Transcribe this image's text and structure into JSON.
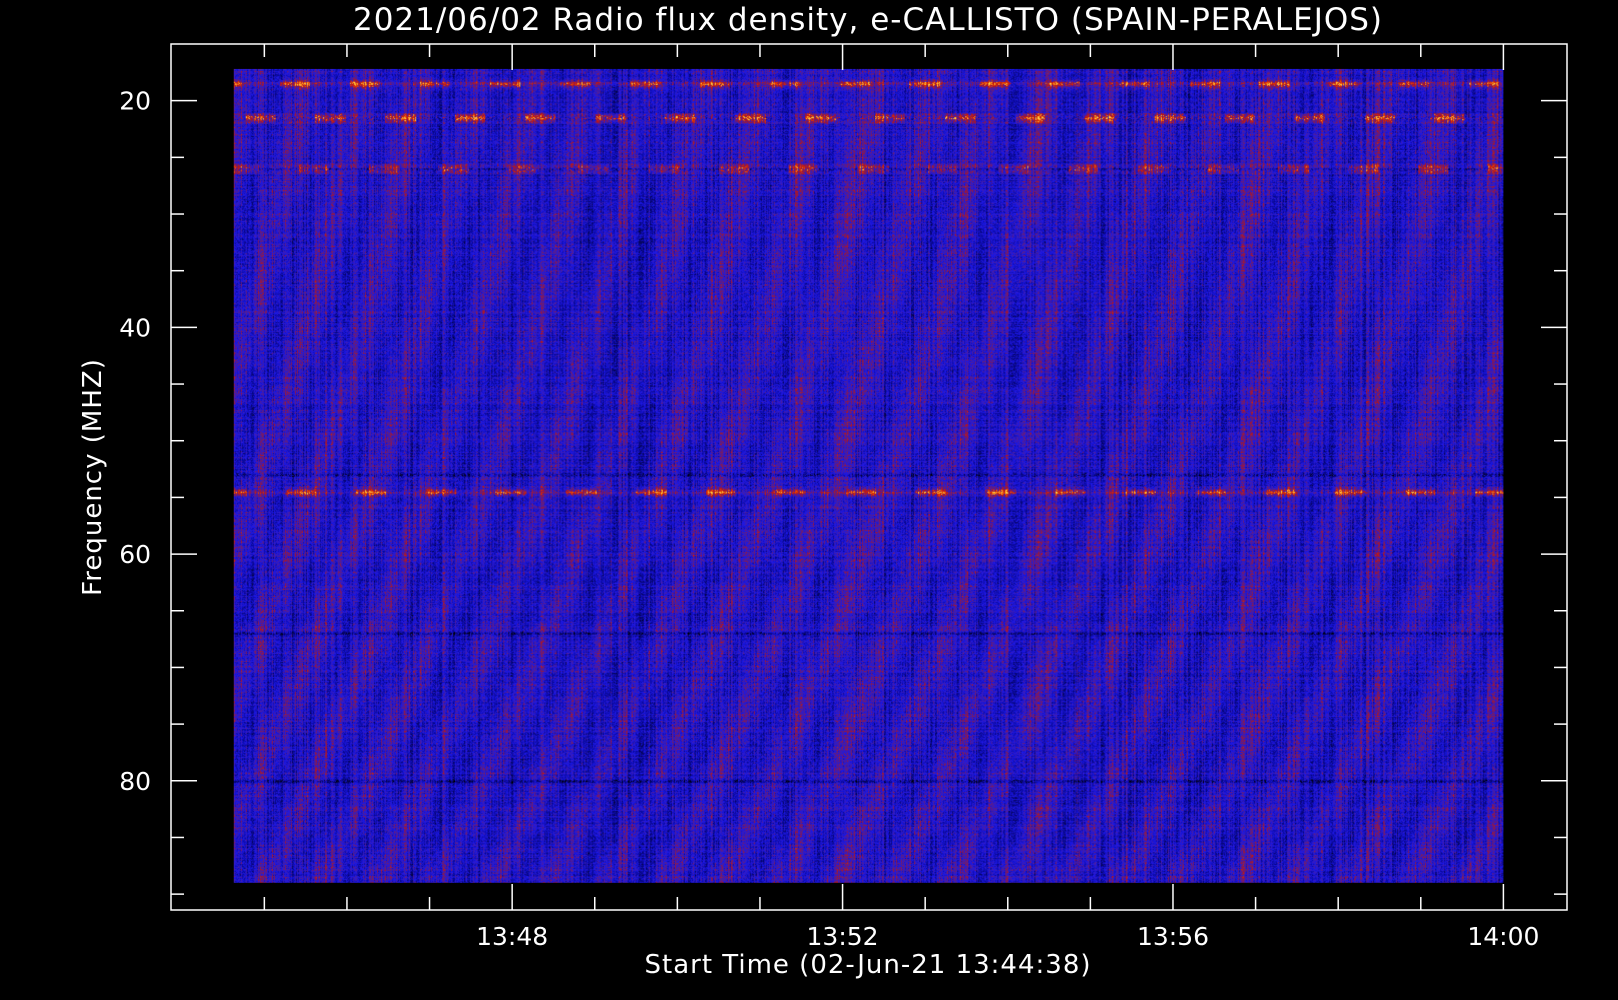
{
  "chart_data": {
    "type": "heatmap",
    "title": "2021/06/02  Radio flux density, e-CALLISTO (SPAIN-PERALEJOS)",
    "xlabel": "Start Time (02-Jun-21 13:44:38)",
    "ylabel": "Frequency (MHZ)",
    "x_ticks": [
      "13:48",
      "13:52",
      "13:56",
      "14:00"
    ],
    "y_ticks": [
      "20",
      "40",
      "60",
      "80"
    ],
    "x_range_minutes_of_hour": [
      44.63,
      60.0
    ],
    "x_axis_range_minutes": [
      43.87,
      60.77
    ],
    "y_range_mhz": [
      17.2,
      89.0
    ],
    "y_axis_range_mhz": [
      15.0,
      91.4
    ],
    "colors": {
      "background": "#000000",
      "base": "#1a17e6",
      "mid": "#6a1a7a",
      "high": "#d81a00",
      "peak": "#ffae2a",
      "axis": "#ffffff"
    },
    "bright_bands_mhz": [
      {
        "freq": 21.5,
        "intensity": "peak"
      },
      {
        "freq": 26.0,
        "intensity": "high"
      },
      {
        "freq": 18.5,
        "intensity": "high"
      },
      {
        "freq": 54.5,
        "intensity": "high"
      }
    ],
    "dark_bands_mhz": [
      21.5,
      26.0,
      53.0,
      67.0,
      80.0
    ]
  }
}
